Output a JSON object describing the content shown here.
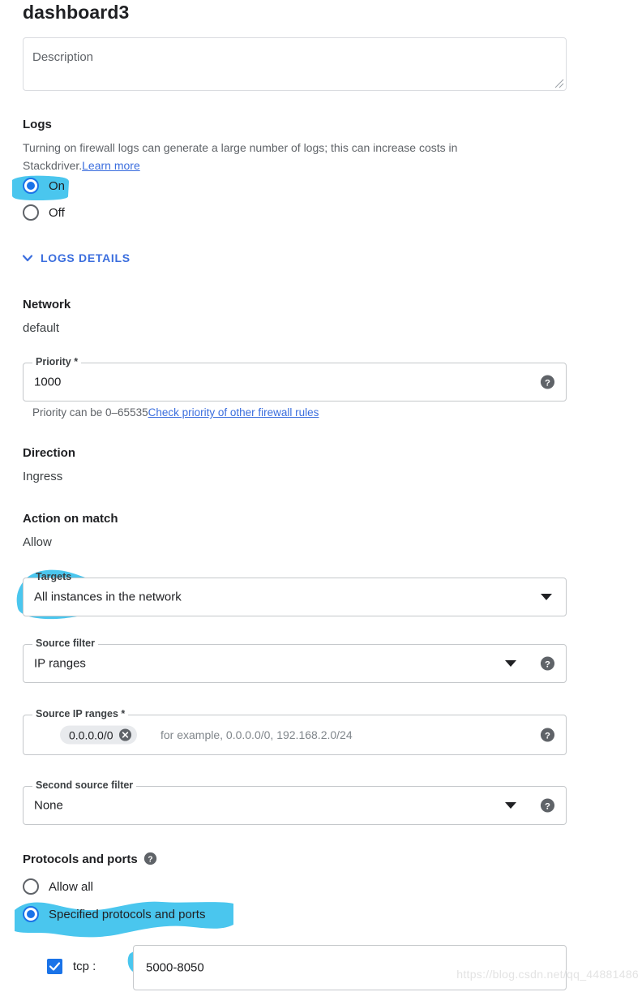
{
  "page": {
    "title": "dashboard3",
    "watermark": "https://blog.csdn.net/qq_44881486"
  },
  "description": {
    "placeholder": "Description",
    "value": ""
  },
  "logs": {
    "heading": "Logs",
    "help_text_part1": "Turning on firewall logs can generate a large number of logs; this can increase costs in Stackdriver.",
    "learn_more": "Learn more",
    "options": [
      {
        "label": "On",
        "selected": true
      },
      {
        "label": "Off",
        "selected": false
      }
    ],
    "details_toggle": "LOGS DETAILS"
  },
  "network": {
    "heading": "Network",
    "value": "default"
  },
  "priority": {
    "label": "Priority *",
    "value": "1000",
    "helper_text": "Priority can be 0–65535",
    "helper_link": "Check priority of other firewall rules",
    "help_icon": "help-icon"
  },
  "direction": {
    "heading": "Direction",
    "value": "Ingress"
  },
  "action_on_match": {
    "heading": "Action on match",
    "value": "Allow"
  },
  "targets": {
    "label": "Targets",
    "value": "All instances in the network"
  },
  "source_filter": {
    "label": "Source filter",
    "value": "IP ranges"
  },
  "source_ip_ranges": {
    "label": "Source IP ranges *",
    "chip": "0.0.0.0/0",
    "placeholder": "for example, 0.0.0.0/0, 192.168.2.0/24"
  },
  "second_source_filter": {
    "label": "Second source filter",
    "value": "None"
  },
  "protocols_and_ports": {
    "heading": "Protocols and ports",
    "options": [
      {
        "label": "Allow all",
        "selected": false
      },
      {
        "label": "Specified protocols and ports",
        "selected": true
      }
    ],
    "tcp": {
      "label": "tcp :",
      "checked": true,
      "ports": "5000-8050"
    }
  },
  "colors": {
    "highlight": "#4ac6ee",
    "link": "#3b6ede",
    "accent": "#1a73e8",
    "border": "#c5c8cb",
    "muted_text": "#5f6368"
  }
}
